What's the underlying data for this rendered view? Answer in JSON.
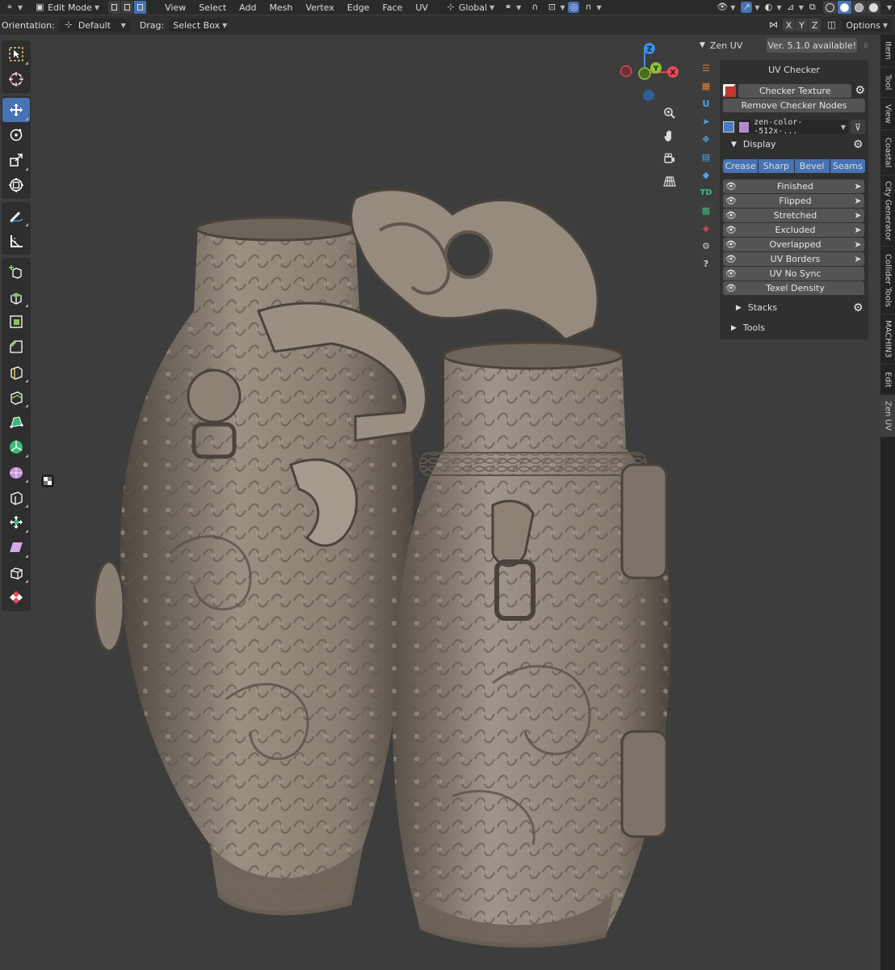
{
  "header": {
    "mode": "Edit Mode",
    "menus": [
      "View",
      "Select",
      "Add",
      "Mesh",
      "Vertex",
      "Edge",
      "Face",
      "UV"
    ],
    "transform_orientation": "Global",
    "mirror_axes": [
      "X",
      "Y",
      "Z"
    ],
    "options_label": "Options"
  },
  "toolsettings": {
    "orientation_label": "Orientation:",
    "orientation_value": "Default",
    "drag_label": "Drag:",
    "drag_value": "Select Box"
  },
  "gizmo": {
    "axis_x": "X",
    "axis_y": "Y",
    "axis_z": "Z"
  },
  "zen_uv": {
    "title": "Zen UV",
    "version_notice": "Ver. 5.1.0 available!",
    "rail_td_label": "TD",
    "rail_u_label": "U",
    "uv_checker_title": "UV Checker",
    "checker_texture_button": "Checker Texture",
    "remove_nodes_button": "Remove Checker Nodes",
    "texture_selector": "zen-color--512x-...",
    "display_section": "Display",
    "display_modes": [
      "Crease",
      "Sharp",
      "Bevel",
      "Seams"
    ],
    "checks": [
      "Finished",
      "Flipped",
      "Stretched",
      "Excluded",
      "Overlapped",
      "UV Borders",
      "UV No Sync",
      "Texel Density"
    ],
    "stacks_section": "Stacks",
    "tools_section": "Tools"
  },
  "side_tabs": [
    "Item",
    "Tool",
    "View",
    "Coastal",
    "City Generator",
    "Collider Tools",
    "MACHIN3",
    "Edit",
    "Zen UV"
  ],
  "colors": {
    "accent": "#4772b3",
    "axis_x": "#e74c5b",
    "axis_y": "#8ac53a",
    "axis_z": "#3f8ee6",
    "model": "#8a7f73"
  }
}
